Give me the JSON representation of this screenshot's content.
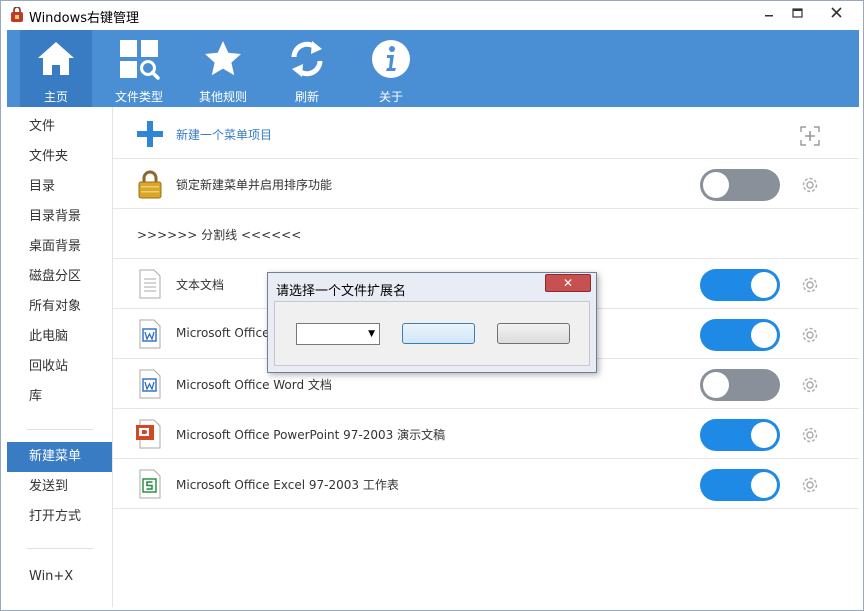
{
  "window": {
    "title": "Windows右键管理"
  },
  "toolbar": {
    "items": [
      {
        "label": "主页",
        "icon": "home-icon"
      },
      {
        "label": "文件类型",
        "icon": "file-type-search-icon"
      },
      {
        "label": "其他规则",
        "icon": "star-icon"
      },
      {
        "label": "刷新",
        "icon": "refresh-icon"
      },
      {
        "label": "关于",
        "icon": "info-icon"
      }
    ]
  },
  "sidebar": {
    "items": [
      "文件",
      "文件夹",
      "目录",
      "目录背景",
      "桌面背景",
      "磁盘分区",
      "所有对象",
      "此电脑",
      "回收站",
      "库",
      "新建菜单",
      "发送到",
      "打开方式",
      "Win+X"
    ],
    "active": "新建菜单"
  },
  "main": {
    "rows": [
      {
        "label": "新建一个菜单项目",
        "icon": "plus-icon",
        "type": "add"
      },
      {
        "label": "锁定新建菜单并启用排序功能",
        "icon": "lock-icon",
        "toggle": "off"
      },
      {
        "label": ">>>>>> 分割线 <<<<<<",
        "type": "separator"
      },
      {
        "label": "文本文档",
        "icon": "text-document-icon",
        "toggle": "on"
      },
      {
        "label": "Microsoft Office",
        "icon": "word-icon",
        "toggle": "on"
      },
      {
        "label": "Microsoft Office Word 文档",
        "icon": "word-icon",
        "toggle": "off"
      },
      {
        "label": "Microsoft Office PowerPoint 97-2003 演示文稿",
        "icon": "powerpoint-icon",
        "toggle": "on"
      },
      {
        "label": "Microsoft Office Excel 97-2003 工作表",
        "icon": "excel-icon",
        "toggle": "on"
      }
    ]
  },
  "dialog": {
    "title": "请选择一个文件扩展名",
    "close_label": "✕",
    "select_value": "",
    "ok_label": "",
    "cancel_label": ""
  },
  "colors": {
    "accent": "#4a8fd4",
    "active": "#3a7cc4",
    "toggle_on": "#1e8ae6",
    "toggle_off": "#8a9099"
  }
}
